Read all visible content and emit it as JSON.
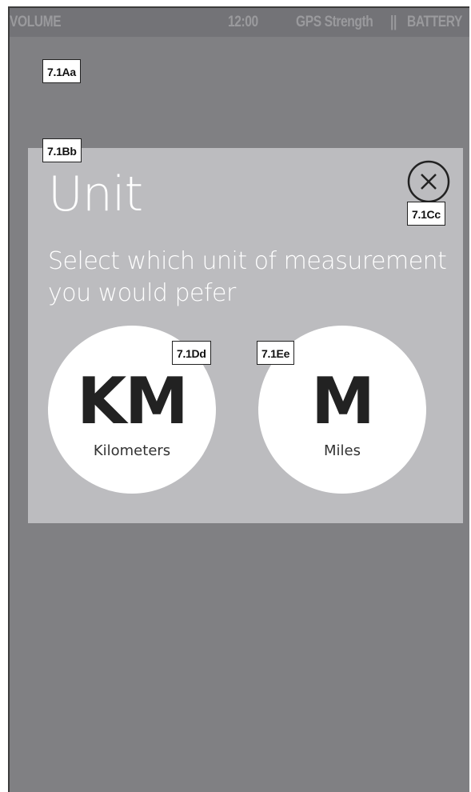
{
  "status_bar": {
    "volume": "VOLUME",
    "time": "12:00",
    "gps": "GPS Strength",
    "separator": "||",
    "battery": "BATTERY"
  },
  "annotations": {
    "a": "7.1Aa",
    "b": "7.1Bb",
    "c": "7.1Cc",
    "d": "7.1Dd",
    "e": "7.1Ee"
  },
  "modal": {
    "title": "Unit",
    "subtitle": "Select which unit of measurement you would pefer",
    "close_icon": "close-circle-icon",
    "options": [
      {
        "abbr": "KM",
        "label": "Kilometers"
      },
      {
        "abbr": "M",
        "label": "Miles"
      }
    ]
  },
  "colors": {
    "background": "#808083",
    "status_bar": "#737377",
    "modal": "#bcbcbf",
    "option_bg": "#ffffff",
    "text_light": "#ffffff",
    "text_dark": "#222222"
  }
}
